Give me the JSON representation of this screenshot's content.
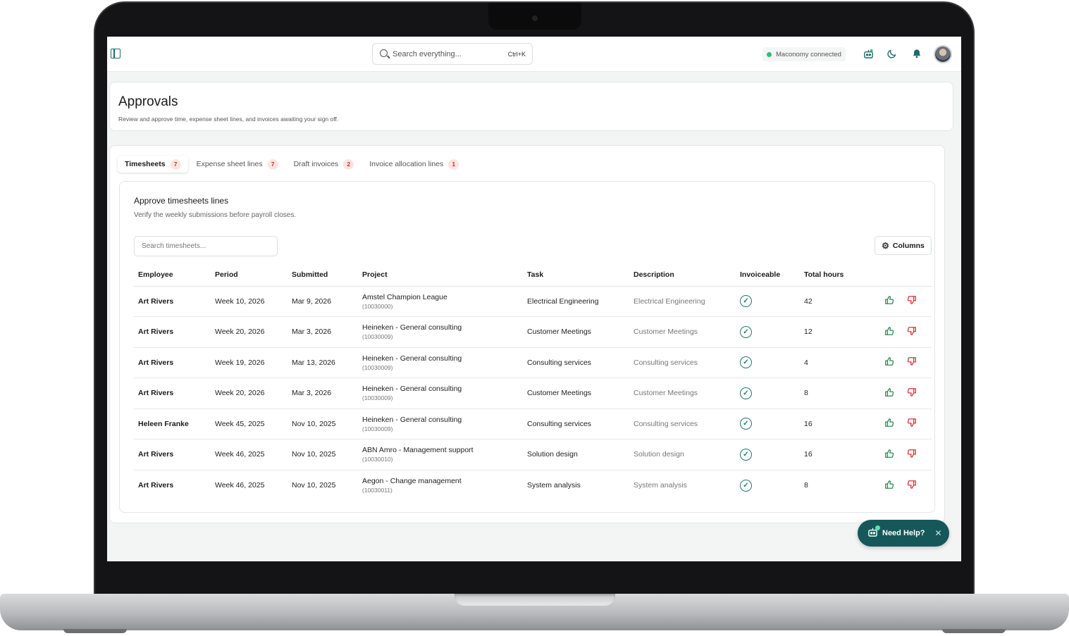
{
  "topbar": {
    "search_placeholder": "Search everything...",
    "search_shortcut": "Ctrl+K",
    "status_text": "Maconomy connected",
    "status_color": "#2fbf71"
  },
  "header": {
    "title": "Approvals",
    "subtitle": "Review and approve time, expense sheet lines, and invoices awaiting your sign off."
  },
  "tabs": [
    {
      "label": "Timesheets",
      "count": "7",
      "active": true
    },
    {
      "label": "Expense sheet lines",
      "count": "7",
      "active": false
    },
    {
      "label": "Draft invoices",
      "count": "2",
      "active": false
    },
    {
      "label": "Invoice allocation lines",
      "count": "1",
      "active": false
    }
  ],
  "section": {
    "title": "Approve timesheets lines",
    "subtitle": "Verify the weekly submissions before payroll closes.",
    "search_placeholder": "Search timesheets...",
    "columns_label": "Columns"
  },
  "table": {
    "headers": {
      "employee": "Employee",
      "period": "Period",
      "submitted": "Submitted",
      "project": "Project",
      "task": "Task",
      "description": "Description",
      "invoiceable": "Invoiceable",
      "total_hours": "Total hours"
    },
    "rows": [
      {
        "employee": "Art Rivers",
        "period": "Week 10, 2026",
        "submitted": "Mar 9, 2026",
        "project": "Amstel Champion League",
        "project_code": "(10030000)",
        "task": "Electrical Engineering",
        "description": "Electrical Engineering",
        "invoiceable": true,
        "hours": "42"
      },
      {
        "employee": "Art Rivers",
        "period": "Week 20, 2026",
        "submitted": "Mar 3, 2026",
        "project": "Heineken - General consulting",
        "project_code": "(10030009)",
        "task": "Customer Meetings",
        "description": "Customer Meetings",
        "invoiceable": true,
        "hours": "12"
      },
      {
        "employee": "Art Rivers",
        "period": "Week 19, 2026",
        "submitted": "Mar 13, 2026",
        "project": "Heineken - General consulting",
        "project_code": "(10030009)",
        "task": "Consulting services",
        "description": "Consulting services",
        "invoiceable": true,
        "hours": "4"
      },
      {
        "employee": "Art Rivers",
        "period": "Week 20, 2026",
        "submitted": "Mar 3, 2026",
        "project": "Heineken - General consulting",
        "project_code": "(10030009)",
        "task": "Customer Meetings",
        "description": "Customer Meetings",
        "invoiceable": true,
        "hours": "8"
      },
      {
        "employee": "Heleen Franke",
        "period": "Week 45, 2025",
        "submitted": "Nov 10, 2025",
        "project": "Heineken - General consulting",
        "project_code": "(10030009)",
        "task": "Consulting services",
        "description": "Consulting services",
        "invoiceable": true,
        "hours": "16"
      },
      {
        "employee": "Art Rivers",
        "period": "Week 46, 2025",
        "submitted": "Nov 10, 2025",
        "project": "ABN Amro - Management support",
        "project_code": "(10030010)",
        "task": "Solution design",
        "description": "Solution design",
        "invoiceable": true,
        "hours": "16"
      },
      {
        "employee": "Art Rivers",
        "period": "Week 46, 2025",
        "submitted": "Nov 10, 2025",
        "project": "Aegon - Change management",
        "project_code": "(10030011)",
        "task": "System analysis",
        "description": "System analysis",
        "invoiceable": true,
        "hours": "8"
      }
    ]
  },
  "help": {
    "label": "Need Help?"
  },
  "icons": {
    "approve": "thumbs-up-icon",
    "reject": "thumbs-down-icon",
    "invoiceable": "check-circle-icon"
  },
  "colors": {
    "accent": "#16585a",
    "approve": "#2e8b57",
    "reject": "#d9343b",
    "badge_bg": "#fde4e1",
    "badge_text": "#c0392b"
  }
}
